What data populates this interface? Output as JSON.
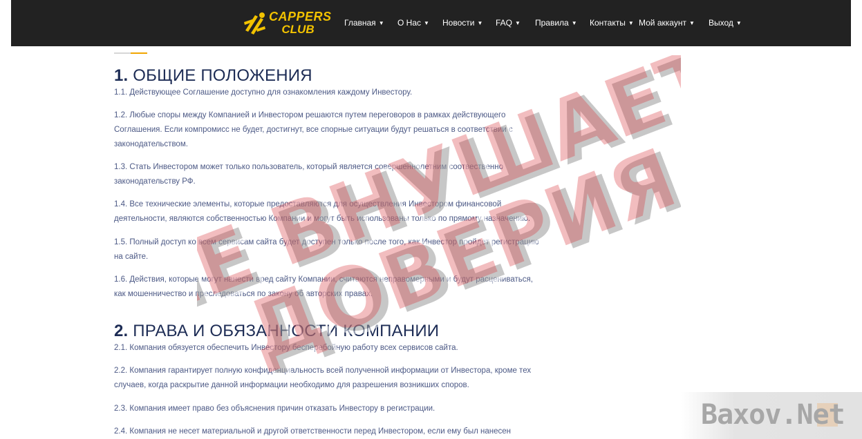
{
  "brand": {
    "line1": "CAPPERS",
    "line2": "CLUB",
    "color": "#f2c200"
  },
  "nav": {
    "items": [
      {
        "label": "Главная"
      },
      {
        "label": "О Нас"
      },
      {
        "label": "Новости"
      },
      {
        "label": "FAQ"
      },
      {
        "label": "Правила"
      },
      {
        "label": "Контакты"
      },
      {
        "label": "Мой аккаунт"
      },
      {
        "label": "Выход"
      }
    ]
  },
  "sections": [
    {
      "number": "1.",
      "title": "ОБЩИЕ ПОЛОЖЕНИЯ",
      "paragraphs": [
        "1.1. Действующее Соглашение доступно для ознакомления каждому Инвестору.",
        "1.2. Любые споры между Компанией и Инвестором решаются путем переговоров в рамках действующего Соглашения. Если компромисс не будет, достигнут, все спорные ситуации будут решаться в соответствии с законодательством.",
        "1.3. Стать Инвестором может только пользователь, который является совершеннолетним соотвественно законодательству РФ.",
        "1.4. Все технические элементы, которые предоставляются для осуществления Инвестором финансовой деятельности, являются собственностью Компании и могут быть использованы только по прямому назначению.",
        "1.5. Полный доступ ко всем сервисам сайта будет доступен только после того, как Инвестор пройдет регистрацию на сайте.",
        "1.6. Действия, которые могут нанести вред сайту Компании, считаются неправомерными и будут расцениваться, как мошенничество и преследоваться по закону об авторских правах."
      ]
    },
    {
      "number": "2.",
      "title": "ПРАВА И ОБЯЗАННОСТИ КОМПАНИИ",
      "paragraphs": [
        "2.1. Компания обязуется обеспечить Инвестору бесперебойную работу всех сервисов сайта.",
        "2.2. Компания гарантирует полную конфиденциальность всей полученной информации от Инвестора, кроме тех случаев, когда раскрытие данной информации необходимо для разрешения возникших споров.",
        "2.3. Компания имеет право без объяснения причин отказать Инвестору в регистрации.",
        "2.4. Компания не несет материальной и другой ответственности перед Инвестором, если ему был нанесен"
      ]
    }
  ],
  "stamp": {
    "line1": "НЕ ВНУШАЕТ",
    "line2": "ДОВЕРИЯ",
    "color": "#d9343c"
  },
  "watermark": {
    "text": "Baxov.Net"
  }
}
